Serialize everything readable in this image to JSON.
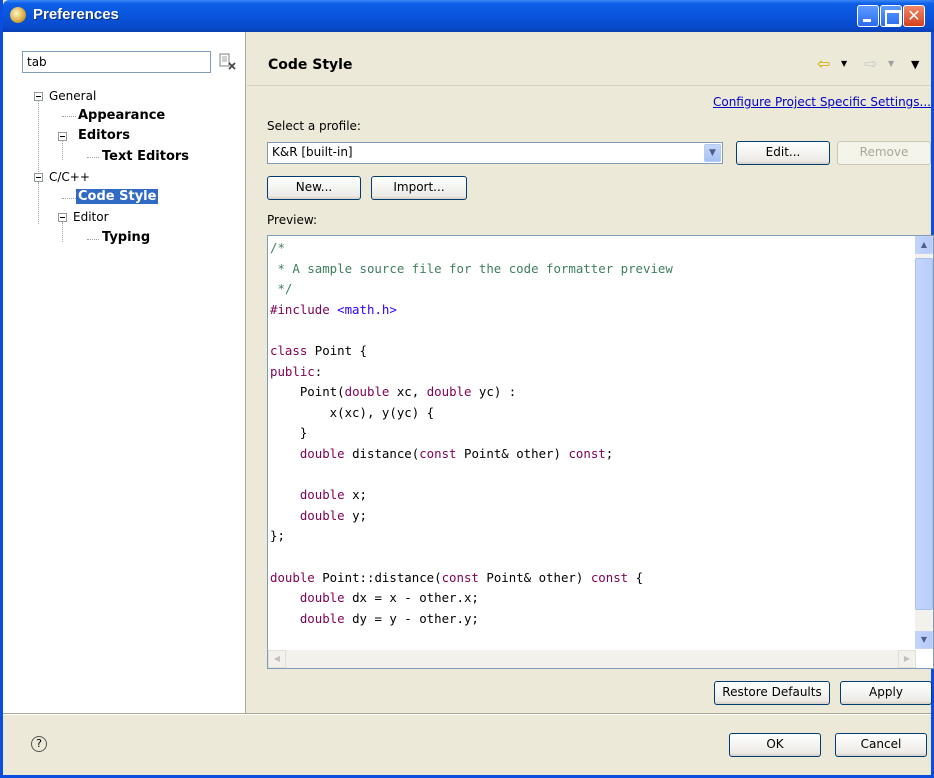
{
  "window": {
    "title": "Preferences"
  },
  "filter": {
    "value": "tab"
  },
  "tree": [
    {
      "label": "General"
    },
    {
      "label": "Appearance"
    },
    {
      "label": "Editors"
    },
    {
      "label": "Text Editors"
    },
    {
      "label": "C/C++"
    },
    {
      "label": "Code Style"
    },
    {
      "label": "Editor"
    },
    {
      "label": "Typing"
    }
  ],
  "page": {
    "title": "Code Style",
    "configure_link": "Configure Project Specific Settings...",
    "profile_label": "Select a profile:",
    "profile_value": "K&R [built-in]",
    "edit_label": "Edit...",
    "remove_label": "Remove",
    "new_label": "New...",
    "import_label": "Import...",
    "preview_label": "Preview:"
  },
  "code_lines": [
    "/*",
    " * A sample source file for the code formatter preview",
    " */",
    "#include <math.h>",
    "",
    "class Point {",
    "public:",
    "    Point(double xc, double yc) :",
    "        x(xc), y(yc) {",
    "    }",
    "    double distance(const Point& other) const;",
    "",
    "    double x;",
    "    double y;",
    "};",
    "",
    "double Point::distance(const Point& other) const {",
    "    double dx = x - other.x;",
    "    double dy = y - other.y;"
  ],
  "buttons": {
    "restore_defaults": "Restore Defaults",
    "apply": "Apply",
    "ok": "OK",
    "cancel": "Cancel"
  },
  "icons": {
    "window": "preferences-icon",
    "help": "help-icon",
    "clear": "clear-filter-icon"
  }
}
